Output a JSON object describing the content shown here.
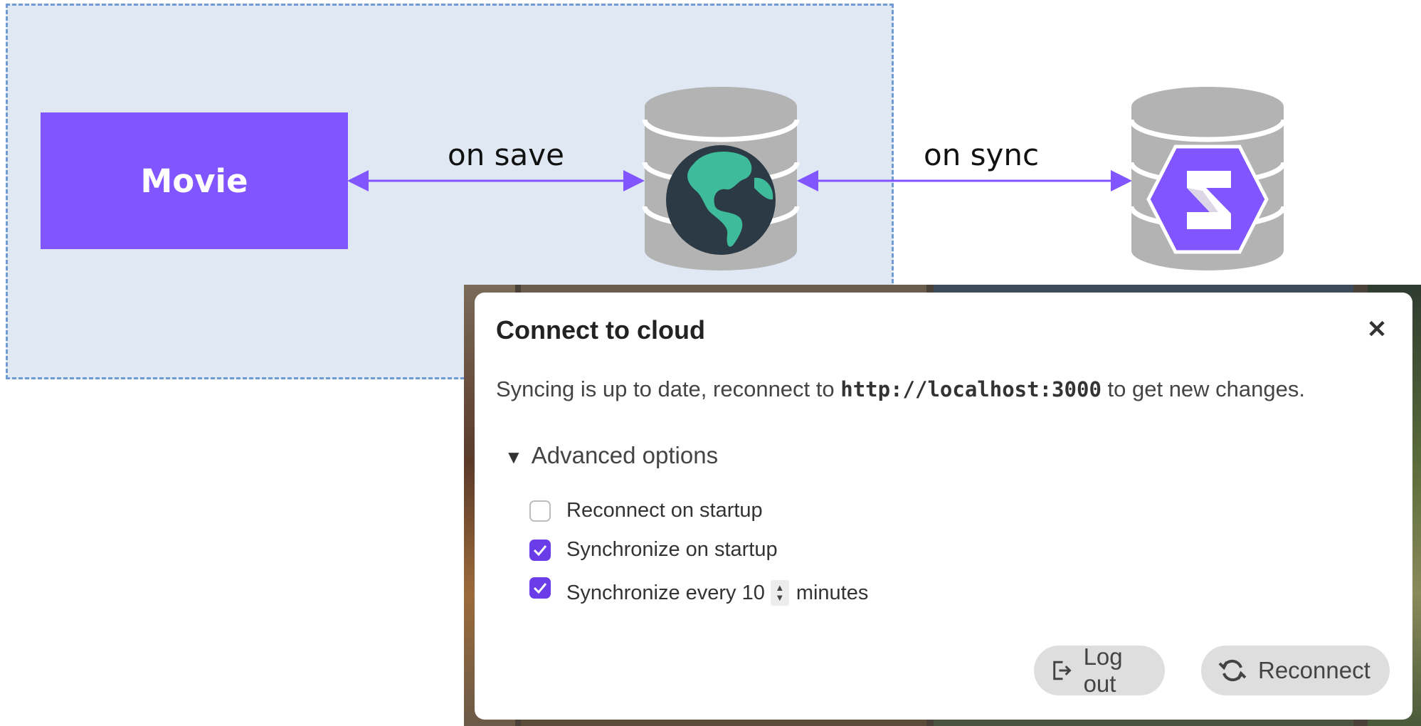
{
  "diagram": {
    "movie_label": "Movie",
    "edge_save_label": "on save",
    "edge_sync_label": "on sync",
    "local_db_icon": "globe-database-icon",
    "remote_db_icon": "hexagon-s-database-icon",
    "colors": {
      "accent": "#8155ff",
      "boundary_fill": "#dfe8f3",
      "boundary_stroke": "#6f9bd0",
      "db_gray": "#b3b3b3"
    }
  },
  "dialog": {
    "title": "Connect to cloud",
    "close_glyph": "✕",
    "status_prefix": "Syncing is up to date, reconnect to ",
    "status_url": "http://localhost:3000",
    "status_suffix": " to get new changes.",
    "advanced_label": "Advanced options",
    "options": [
      {
        "label": "Reconnect on startup",
        "checked": false
      },
      {
        "label": "Synchronize on startup",
        "checked": true
      },
      {
        "label_prefix": "Synchronize every",
        "value": "10",
        "label_suffix": "minutes",
        "checked": true
      }
    ],
    "logout_label": "Log out",
    "reconnect_label": "Reconnect"
  }
}
